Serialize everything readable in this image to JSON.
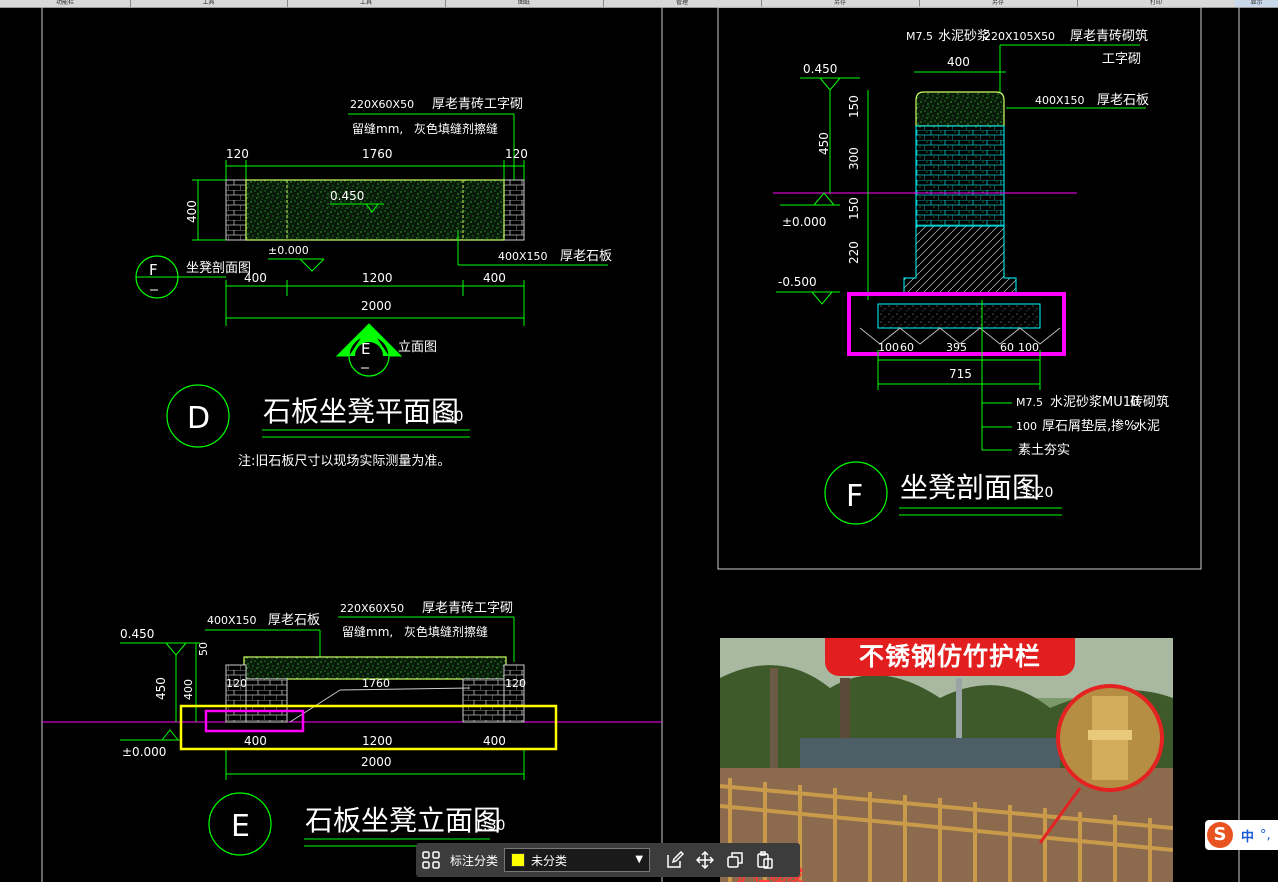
{
  "tabs": [
    "功能栏",
    "工具",
    "工具",
    "图纸",
    "管理",
    "另存",
    "另存",
    "打印",
    "显示"
  ],
  "plan": {
    "tags": [
      "220X60X50",
      "厚老青砖工字砌"
    ],
    "note": [
      "留缝mm,",
      "灰色填缝剂擦缝"
    ],
    "dims_top": [
      "120",
      "1760",
      "120"
    ],
    "height_dim": "400",
    "level": "0.450",
    "level0": "±0.000",
    "slab_tag": [
      "400X150",
      "厚老石板"
    ],
    "section_mark": "F",
    "section_label": "坐凳剖面图",
    "dims_bottom": [
      "400",
      "1200",
      "400"
    ],
    "dim_total": "2000",
    "elev_mark": "E",
    "elev_label": "立面图",
    "title_mark": "D",
    "title": "石板坐凳平面图",
    "scale": "1:30",
    "note_line": "注:旧石板尺寸以现场实际测量为准。"
  },
  "elevation": {
    "level_top": "0.450",
    "level0": "±0.000",
    "dim_450": "450",
    "dim_400": "400",
    "dim_50": "50",
    "slab_tag": [
      "400X150",
      "厚老石板"
    ],
    "tags": [
      "220X60X50",
      "厚老青砖工字砌"
    ],
    "note": [
      "留缝mm,",
      "灰色填缝剂擦缝"
    ],
    "dims_top": [
      "120",
      "1760",
      "120"
    ],
    "dims_bottom": [
      "400",
      "1200",
      "400"
    ],
    "dim_total": "2000",
    "title_mark": "E",
    "title": "石板坐凳立面图",
    "scale": "1:30"
  },
  "section": {
    "top_tag": [
      "M7.5",
      "水泥砂浆",
      "220X105X50",
      "厚老青砖砌筑"
    ],
    "top_tag2": "工字砌",
    "width_top": "400",
    "slab_tag": [
      "400X150",
      "厚老石板"
    ],
    "level_top": "0.450",
    "level0": "±0.000",
    "level_neg": "-0.500",
    "dim_450": "450",
    "dims_v": [
      "150",
      "300",
      "150",
      "220"
    ],
    "dims_bottom": [
      "100",
      "60",
      "395",
      "60",
      "100"
    ],
    "dim_total": "715",
    "layers": [
      [
        "M7.5",
        "水泥砂浆MU10",
        "砖砌筑"
      ],
      [
        "100",
        "厚石屑垫层,掺%",
        "水泥"
      ],
      [
        "",
        "素土夯实",
        ""
      ]
    ],
    "title_mark": "F",
    "title": "坐凳剖面图",
    "scale": "1:20"
  },
  "photo": {
    "banner": "不锈钢仿竹护栏",
    "caption": "护栏秘发"
  },
  "toolbar": {
    "category_label": "标注分类",
    "category_value": "未分类"
  },
  "ime": {
    "lang": "中",
    "sym": "°,"
  },
  "colors": {
    "cad_line": "#00ff00",
    "section_line": "#00ffff",
    "magenta": "#ff00ff",
    "yellow": "#ffff00"
  }
}
